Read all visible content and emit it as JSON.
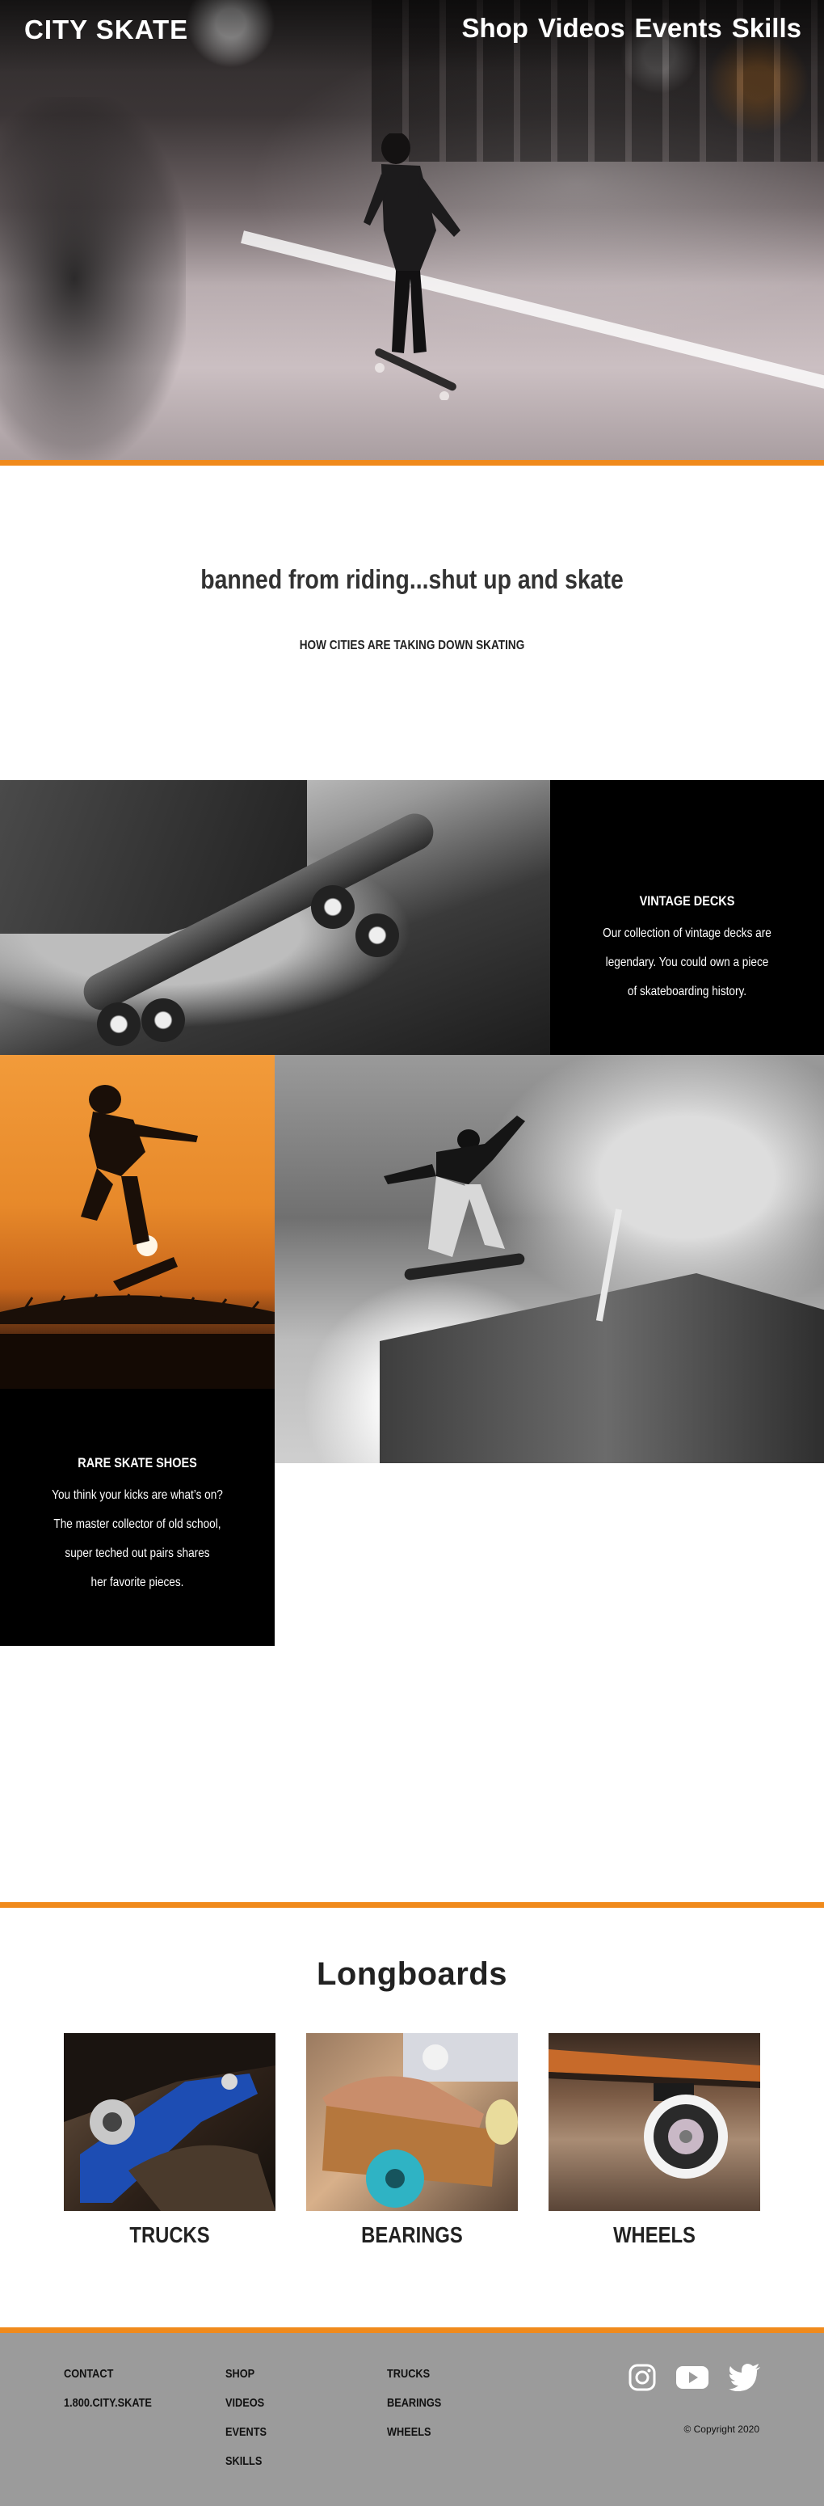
{
  "header": {
    "logo": "CITY SKATE",
    "nav": [
      "Shop",
      "Videos",
      "Events",
      "Skills"
    ]
  },
  "intro": {
    "headline": "banned from riding...shut up and skate",
    "link": "HOW CITIES ARE TAKING DOWN SKATING"
  },
  "features": {
    "vintage": {
      "title": "VINTAGE DECKS",
      "lines": [
        "Our collection of vintage decks are",
        "legendary. You could own a piece",
        "of  skateboarding history."
      ]
    },
    "shoes": {
      "title": "RARE SKATE SHOES",
      "lines": [
        "You think your kicks are what’s on?",
        "The master collector of old school,",
        "super teched out pairs shares",
        "her favorite pieces."
      ]
    }
  },
  "longboards": {
    "title": "Longboards",
    "items": [
      {
        "label": "TRUCKS"
      },
      {
        "label": "BEARINGS"
      },
      {
        "label": "WHEELS"
      }
    ]
  },
  "footer": {
    "contact": [
      "CONTACT",
      "1.800.CITY.SKATE"
    ],
    "nav": [
      "SHOP",
      "VIDEOS",
      "EVENTS",
      "SKILLS"
    ],
    "parts": [
      "TRUCKS",
      "BEARINGS",
      "WHEELS"
    ],
    "social_icons": [
      "instagram-icon",
      "youtube-icon",
      "twitter-icon"
    ],
    "copyright": "© Copyright 2020"
  },
  "colors": {
    "accent": "#f08a1c",
    "footer_bg": "#9b9b9b",
    "info_bg": "#000000"
  }
}
